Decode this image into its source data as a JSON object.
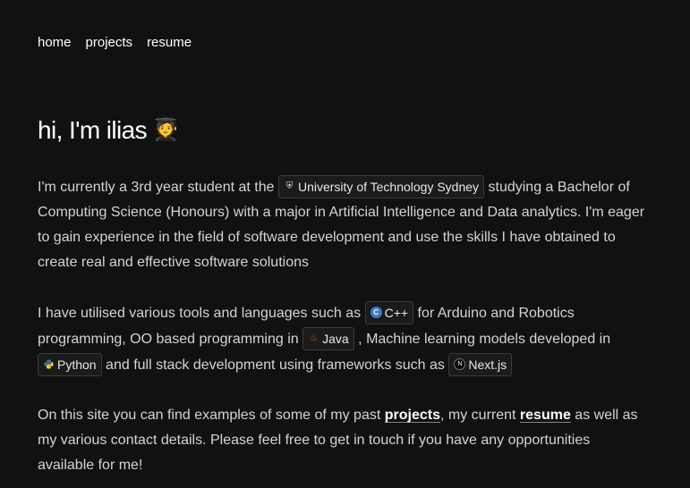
{
  "nav": {
    "items": [
      "home",
      "projects",
      "resume"
    ]
  },
  "hero": {
    "title": "hi, I'm ilias",
    "emoji": "🧑‍🎓"
  },
  "paragraph1": {
    "text_before": "I'm currently a 3rd year student at the",
    "chip_label": "University of Technology Sydney",
    "chip_icon": "shield-icon",
    "text_after": "studying a Bachelor of Computing Science (Honours) with a major in Artificial Intelligence and Data analytics. I'm eager to gain experience in the field of software development and use the skills I have obtained to create real and effective software solutions"
  },
  "paragraph2": {
    "text_1": "I have utilised various tools and languages such as",
    "chip_cpp": "C++",
    "text_2": "for Arduino and Robotics programming, OO based programming in",
    "chip_java": "Java",
    "text_3": ", Machine learning models developed in",
    "chip_python": "Python",
    "text_4": "and full stack development using frameworks such as",
    "chip_next": "Next.js"
  },
  "paragraph3": {
    "text_1": "On this site you can find examples of some of my past",
    "link_projects": "projects",
    "text_2": ", my current",
    "link_resume": "resume",
    "text_3": "as well as my various contact details. Please feel free to get in touch if you have any opportunities available for me!"
  },
  "colors": {
    "background": "#111111",
    "text": "#d4d4d4",
    "heading": "#ffffff",
    "chip_border": "#3a3a3a"
  }
}
